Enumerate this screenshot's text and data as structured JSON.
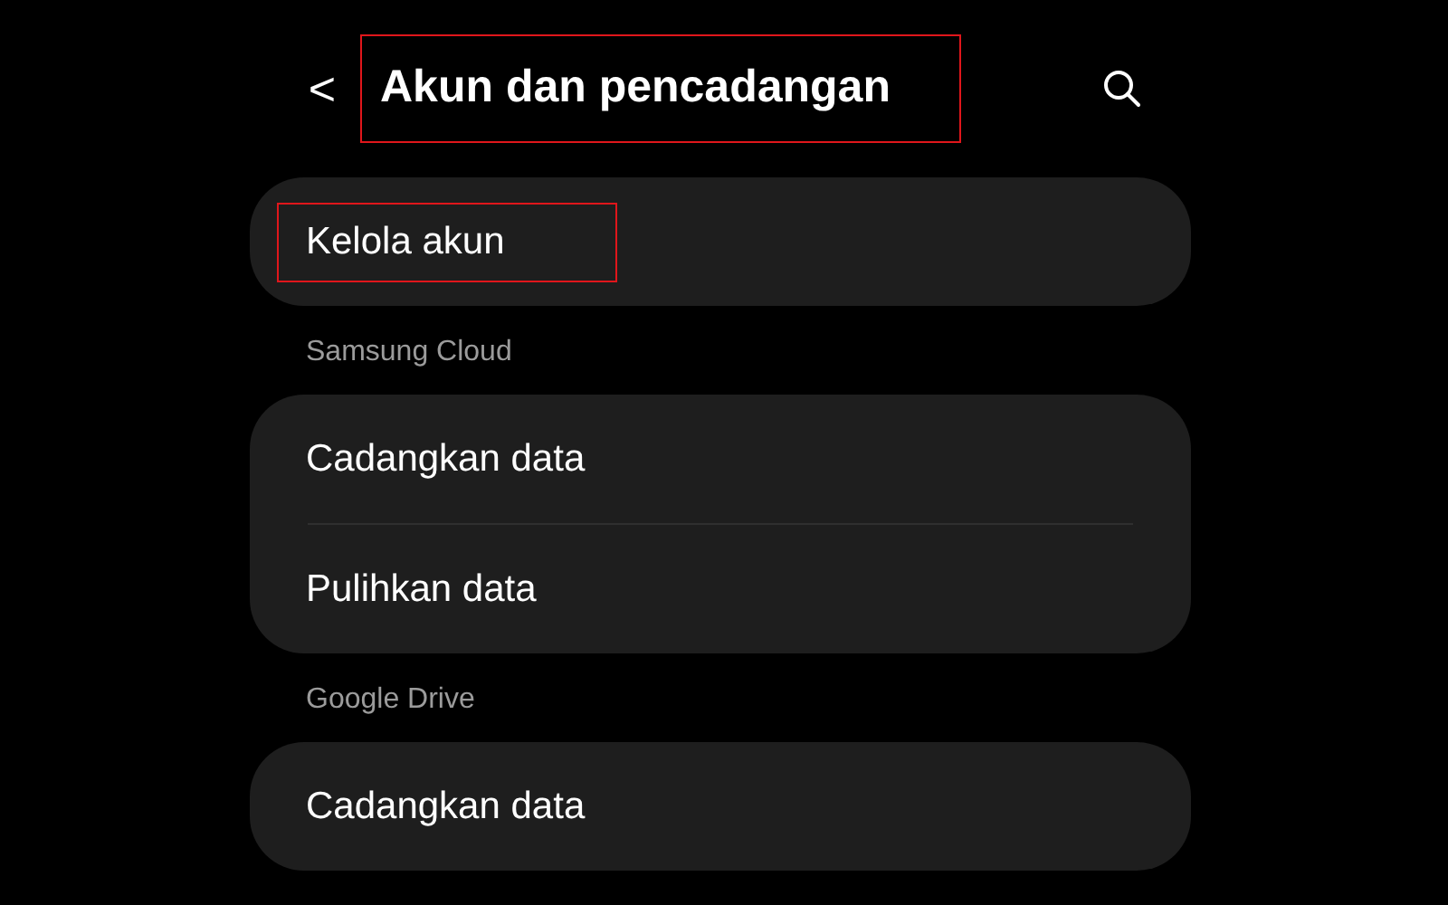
{
  "header": {
    "back": "<",
    "title": "Akun dan pencadangan",
    "title_highlighted": true
  },
  "groups": [
    {
      "items": [
        {
          "label": "Kelola akun",
          "highlighted": true
        }
      ]
    },
    {
      "heading": "Samsung Cloud",
      "items": [
        {
          "label": "Cadangkan data",
          "highlighted": false
        },
        {
          "label": "Pulihkan data",
          "highlighted": false
        }
      ]
    },
    {
      "heading": "Google Drive",
      "items": [
        {
          "label": "Cadangkan data",
          "highlighted": false
        }
      ]
    }
  ]
}
